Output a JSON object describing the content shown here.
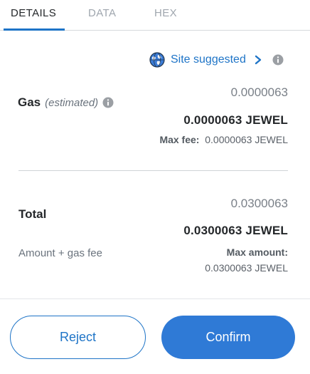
{
  "tabs": [
    {
      "label": "DETAILS",
      "active": true
    },
    {
      "label": "DATA",
      "active": false
    },
    {
      "label": "HEX",
      "active": false
    }
  ],
  "site_suggested": {
    "label": "Site suggested",
    "icon": "globe-icon"
  },
  "gas": {
    "title": "Gas",
    "estimated": "(estimated)",
    "secondary_value": "0.0000063",
    "primary_value": "0.0000063 JEWEL",
    "max_fee_label": "Max fee:",
    "max_fee_value": "0.0000063 JEWEL"
  },
  "total": {
    "title": "Total",
    "secondary_value": "0.0300063",
    "primary_value": "0.0300063 JEWEL",
    "amount_gas_label": "Amount + gas fee",
    "max_amount_label": "Max amount:",
    "max_amount_value": "0.0300063 JEWEL"
  },
  "buttons": {
    "reject": "Reject",
    "confirm": "Confirm"
  },
  "colors": {
    "accent": "#1e74c7",
    "confirm_bg": "#2f7ad6",
    "text": "#24272a",
    "muted": "#6a737d"
  }
}
